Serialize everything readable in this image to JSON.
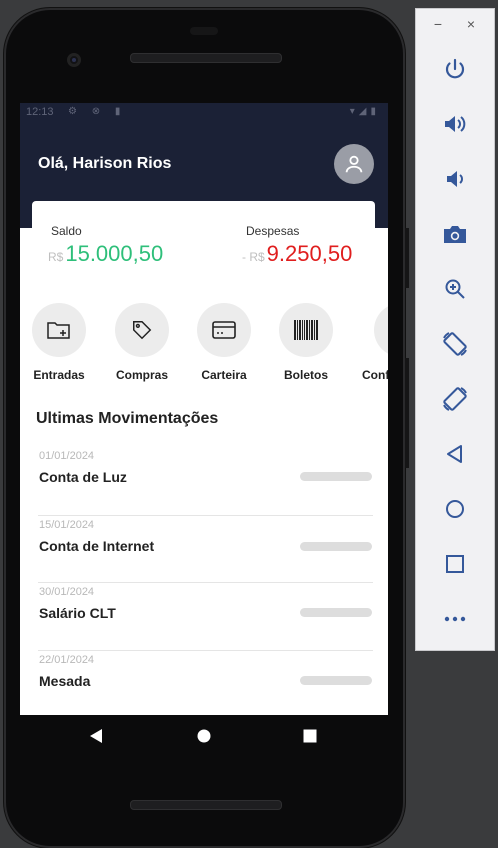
{
  "status_bar": {
    "time": "12:13",
    "left_icons": "⚙ ⊗ ▮",
    "right_icons": "▾◢▮"
  },
  "header": {
    "greeting": "Olá, Harison Rios"
  },
  "balance": {
    "saldo_label": "Saldo",
    "saldo_prefix": "R$",
    "saldo_value": "15.000,50",
    "despesas_label": "Despesas",
    "despesas_prefix": "- R$",
    "despesas_value": "9.250,50",
    "saldo_color": "#2ebf7a",
    "despesas_color": "#e01e1e"
  },
  "actions": [
    {
      "label": "Entradas",
      "icon": "folder-add-icon"
    },
    {
      "label": "Compras",
      "icon": "tag-icon"
    },
    {
      "label": "Carteira",
      "icon": "credit-card-icon"
    },
    {
      "label": "Boletos",
      "icon": "barcode-icon"
    },
    {
      "label": "Conf",
      "icon": "settings-icon"
    }
  ],
  "movements": {
    "title": "Ultimas Movimentações",
    "items": [
      {
        "date": "01/01/2024",
        "name": "Conta de Luz"
      },
      {
        "date": "15/01/2024",
        "name": "Conta de Internet"
      },
      {
        "date": "30/01/2024",
        "name": "Salário CLT"
      },
      {
        "date": "22/01/2024",
        "name": "Mesada"
      }
    ]
  },
  "theme": {
    "header_bg": "#1b2136",
    "accent_gray": "#ececec"
  },
  "emulator_toolbar": {
    "minimize": "−",
    "close": "×"
  }
}
